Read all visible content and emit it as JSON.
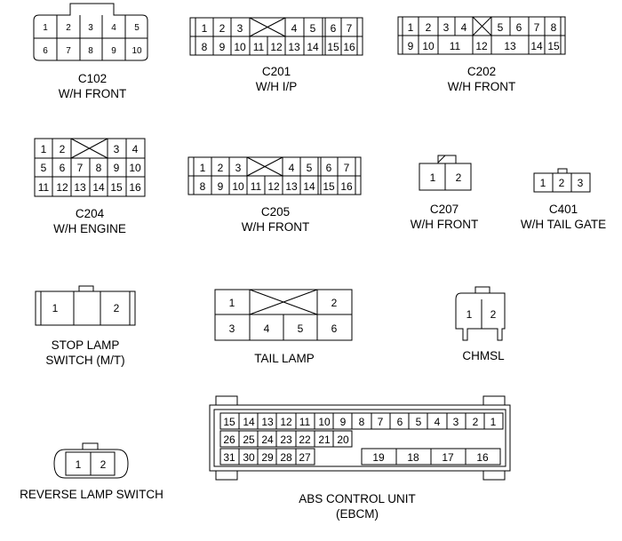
{
  "labels": {
    "c102_id": "C102",
    "c102_desc": "W/H FRONT",
    "c201_id": "C201",
    "c201_desc": "W/H I/P",
    "c202_id": "C202",
    "c202_desc": "W/H FRONT",
    "c204_id": "C204",
    "c204_desc": "W/H ENGINE",
    "c205_id": "C205",
    "c205_desc": "W/H FRONT",
    "c207_id": "C207",
    "c207_desc": "W/H FRONT",
    "c401_id": "C401",
    "c401_desc": "W/H TAIL GATE",
    "stop_line1": "STOP LAMP",
    "stop_line2": "SWITCH (M/T)",
    "tail": "TAIL LAMP",
    "chmsl": "CHMSL",
    "reverse": "REVERSE LAMP SWITCH",
    "abs_line1": "ABS CONTROL UNIT",
    "abs_line2": "(EBCM)"
  },
  "pins": {
    "c102_top": [
      "1",
      "2",
      "3",
      "4",
      "5"
    ],
    "c102_bottom": [
      "6",
      "7",
      "8",
      "9",
      "10"
    ],
    "c201_top": [
      "1",
      "2",
      "3",
      "4",
      "5",
      "6",
      "7"
    ],
    "c201_bottom": [
      "8",
      "9",
      "10",
      "11",
      "12",
      "13",
      "14",
      "15",
      "16"
    ],
    "c202_top": [
      "1",
      "2",
      "3",
      "4",
      "5",
      "6",
      "7",
      "8"
    ],
    "c202_bottom": [
      "9",
      "10",
      "11",
      "12",
      "13",
      "14",
      "15"
    ],
    "c204_row1": [
      "1",
      "2",
      "3",
      "4"
    ],
    "c204_row2": [
      "5",
      "6",
      "7",
      "8",
      "9",
      "10"
    ],
    "c204_row3": [
      "11",
      "12",
      "13",
      "14",
      "15",
      "16"
    ],
    "c205_top": [
      "1",
      "2",
      "3",
      "4",
      "5",
      "6",
      "7"
    ],
    "c205_bottom": [
      "8",
      "9",
      "10",
      "11",
      "12",
      "13",
      "14",
      "15",
      "16"
    ],
    "c207": [
      "1",
      "2"
    ],
    "c401": [
      "1",
      "2",
      "3"
    ],
    "stop": [
      "1",
      "2"
    ],
    "tail_top": [
      "1",
      "2"
    ],
    "tail_bottom": [
      "3",
      "4",
      "5",
      "6"
    ],
    "chmsl": [
      "1",
      "2"
    ],
    "reverse": [
      "1",
      "2"
    ],
    "abs_row1": [
      "15",
      "14",
      "13",
      "12",
      "11",
      "10",
      "9",
      "8",
      "7",
      "6",
      "5",
      "4",
      "3",
      "2",
      "1"
    ],
    "abs_row2": [
      "26",
      "25",
      "24",
      "23",
      "22",
      "21",
      "20"
    ],
    "abs_row3a": [
      "31",
      "30",
      "29",
      "28",
      "27"
    ],
    "abs_row3b": [
      "19",
      "18",
      "17",
      "16"
    ]
  }
}
